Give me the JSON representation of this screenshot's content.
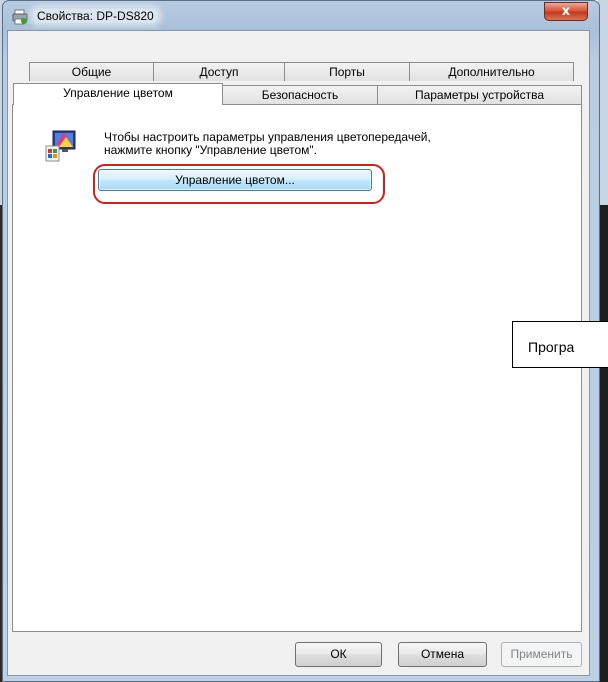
{
  "window": {
    "title": "Свойства: DP-DS820",
    "close_glyph": "x"
  },
  "tabs_row1": [
    "Общие",
    "Доступ",
    "Порты",
    "Дополнительно"
  ],
  "tabs_row2": [
    "Управление цветом",
    "Безопасность",
    "Параметры устройства"
  ],
  "selected_tab": "Управление цветом",
  "panel": {
    "icon": "color-management-icon",
    "description_line1": "Чтобы настроить параметры управления цветопередачей,",
    "description_line2": "нажмите кнопку \"Управление цветом\".",
    "manage_button_label": "Управление цветом...",
    "highlight_color": "#d41f1f"
  },
  "callout_text": "Програ",
  "buttons": {
    "ok": "ОК",
    "cancel": "Отмена",
    "apply": "Применить"
  }
}
